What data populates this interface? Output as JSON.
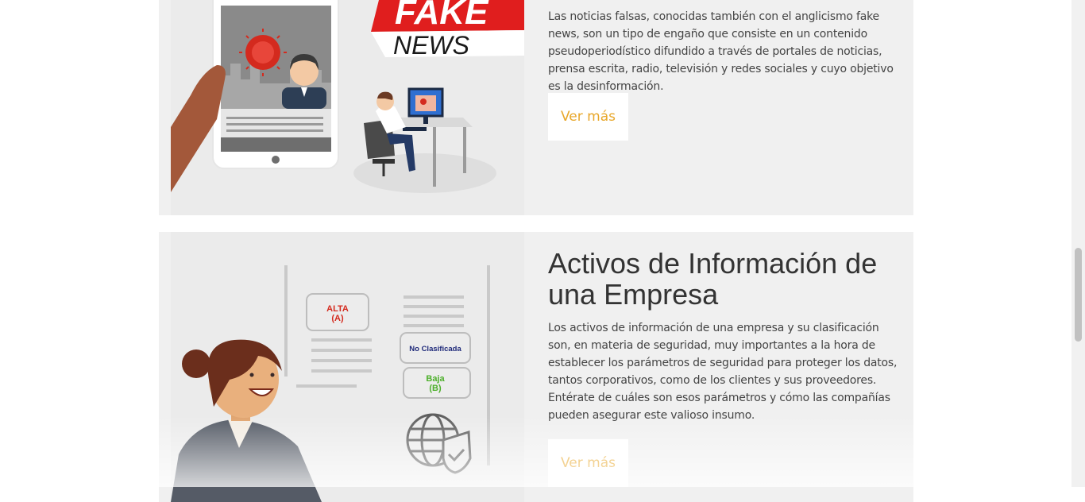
{
  "cards": [
    {
      "illustration": {
        "logo_line1": "FAKE",
        "logo_line2": "NEWS"
      },
      "description": "Las noticias falsas, conocidas también con el anglicismo fake news, son un tipo de engaño que consiste en un contenido pseudoperiodístico difundido a través de portales de noticias, prensa escrita, radio, televisión y redes sociales y cuyo objetivo es la desinformación.",
      "button_label": "Ver más"
    },
    {
      "title": "Activos de Información de una Empresa",
      "illustration": {
        "tag_alta_1": "ALTA",
        "tag_alta_2": "(A)",
        "tag_no_clasificada": "No Clasificada",
        "tag_baja_1": "Baja",
        "tag_baja_2": "(B)"
      },
      "description": "Los activos de información de una empresa y su clasificación son, en materia de seguridad, muy importantes a la hora de establecer los parámetros de seguridad para proteger los datos, tantos corporativos, como de los clientes y sus proveedores. Entérate de cuáles son esos parámetros y cómo las compañías pueden asegurar este valioso insumo.",
      "button_label": "Ver más"
    }
  ],
  "colors": {
    "accent": "#e8a72a",
    "card_bg": "#f0f0f0",
    "fake_news_red": "#e01e1e"
  }
}
